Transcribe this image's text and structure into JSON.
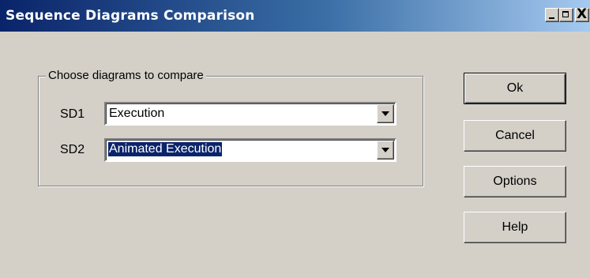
{
  "window": {
    "title": "Sequence Diagrams Comparison",
    "controls": {
      "minimize_icon": "minimize-icon",
      "maximize_icon": "maximize-icon",
      "close_glyph": "X"
    }
  },
  "group": {
    "label": "Choose diagrams to compare"
  },
  "sd1": {
    "label": "SD1",
    "value": "Execution"
  },
  "sd2": {
    "label": "SD2",
    "value": "Animated Execution"
  },
  "buttons": {
    "ok": "Ok",
    "cancel": "Cancel",
    "options": "Options",
    "help": "Help"
  },
  "colors": {
    "face": "#d4d0c8",
    "titlebar_start": "#0a246a",
    "titlebar_end": "#a6caf0",
    "selection": "#0a246a"
  }
}
